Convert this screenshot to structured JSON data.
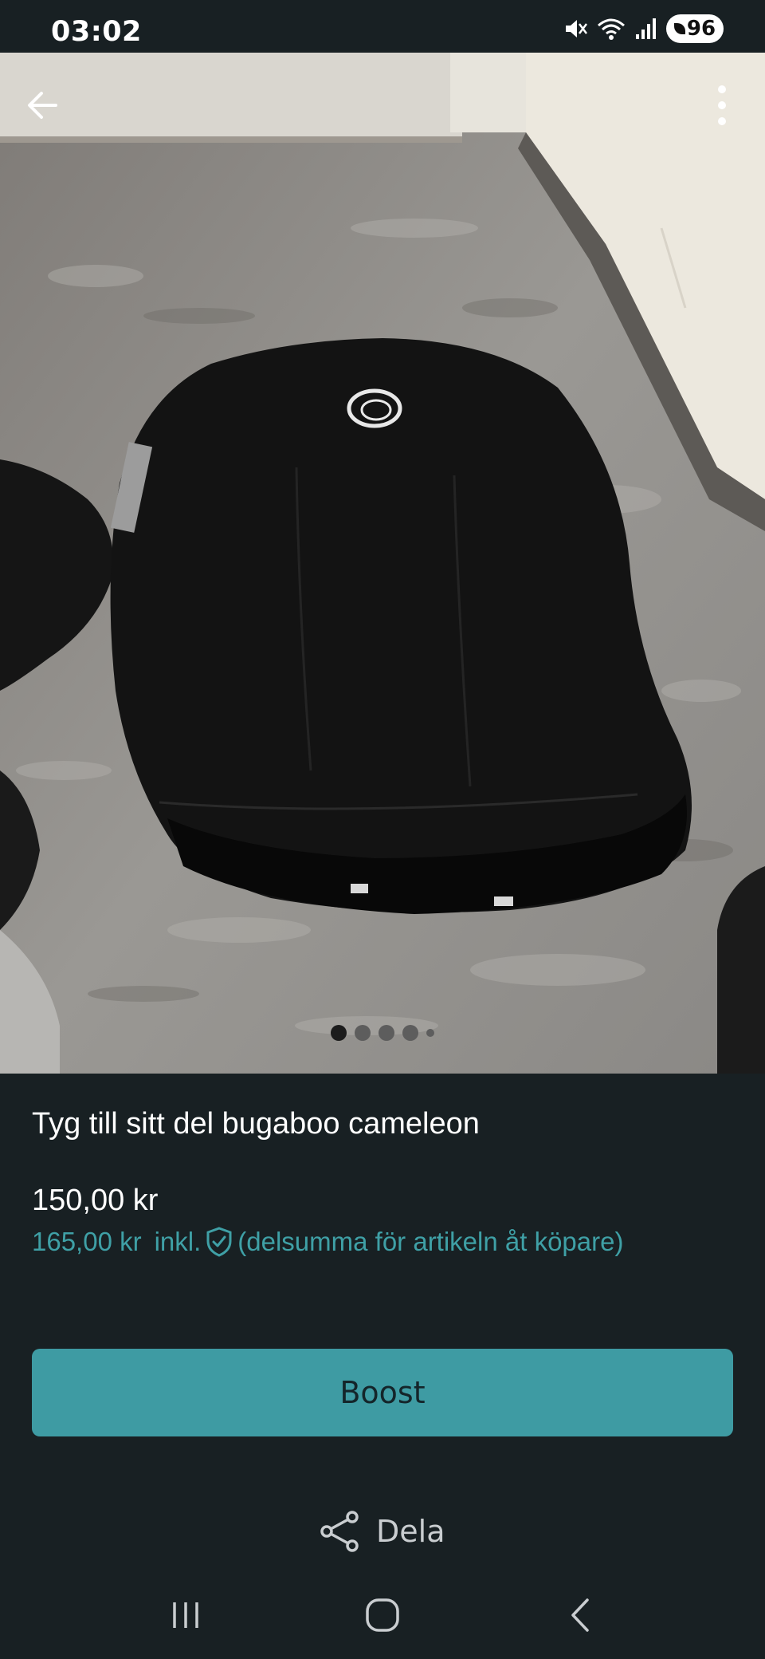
{
  "status_bar": {
    "time": "03:02",
    "battery": "96",
    "icons": [
      "mute-icon",
      "wifi-icon",
      "signal-icon",
      "battery-icon"
    ]
  },
  "header": {
    "back_icon": "arrow-left-icon",
    "more_icon": "more-vertical-icon"
  },
  "carousel": {
    "total_dots": 5,
    "active_index": 0
  },
  "listing": {
    "title": "Tyg till sitt del bugaboo cameleon",
    "price": "150,00 kr",
    "buyer_price": "165,00 kr",
    "buyer_price_incl": "inkl.",
    "buyer_price_note": "(delsumma för artikeln åt köpare)"
  },
  "actions": {
    "boost_label": "Boost",
    "share_label": "Dela"
  },
  "colors": {
    "background": "#182023",
    "accent": "#3e9ba3",
    "accent_text": "#3fa0a6"
  }
}
